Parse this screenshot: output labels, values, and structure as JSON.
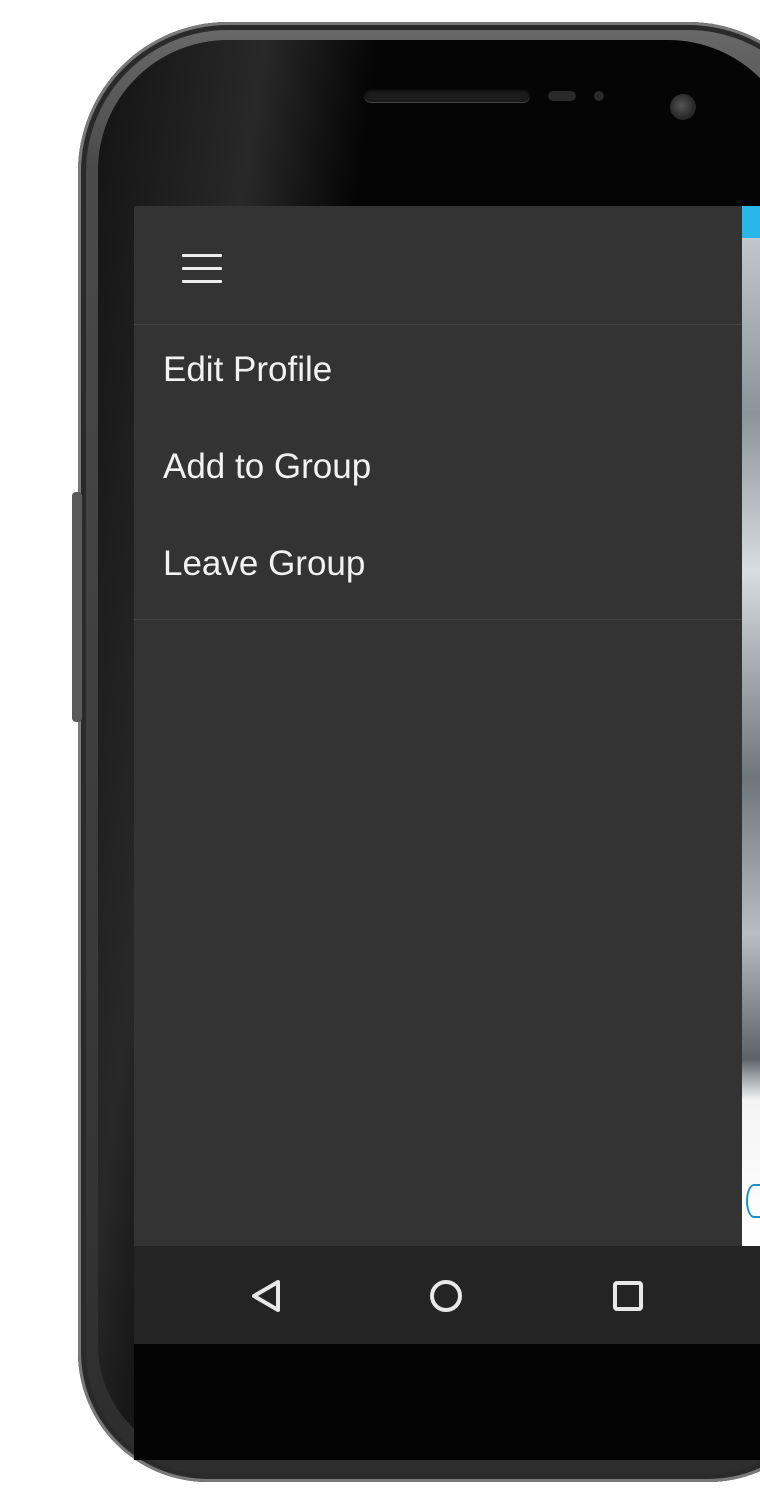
{
  "device": {
    "frame": "phone-frame",
    "screen": "app-screen"
  },
  "drawer": {
    "menu_icon": "hamburger-icon",
    "items": [
      {
        "label": "Edit Profile"
      },
      {
        "label": "Add to Group"
      },
      {
        "label": "Leave Group"
      }
    ]
  },
  "nav_bar": {
    "back_icon": "back-triangle-icon",
    "home_icon": "home-circle-icon",
    "recents_icon": "recents-square-icon"
  },
  "colors": {
    "drawer_background": "#333333",
    "drawer_text": "#f2f2f2",
    "divider": "#444444",
    "nav_bar_background": "#242424",
    "accent": "#29b6e8"
  }
}
